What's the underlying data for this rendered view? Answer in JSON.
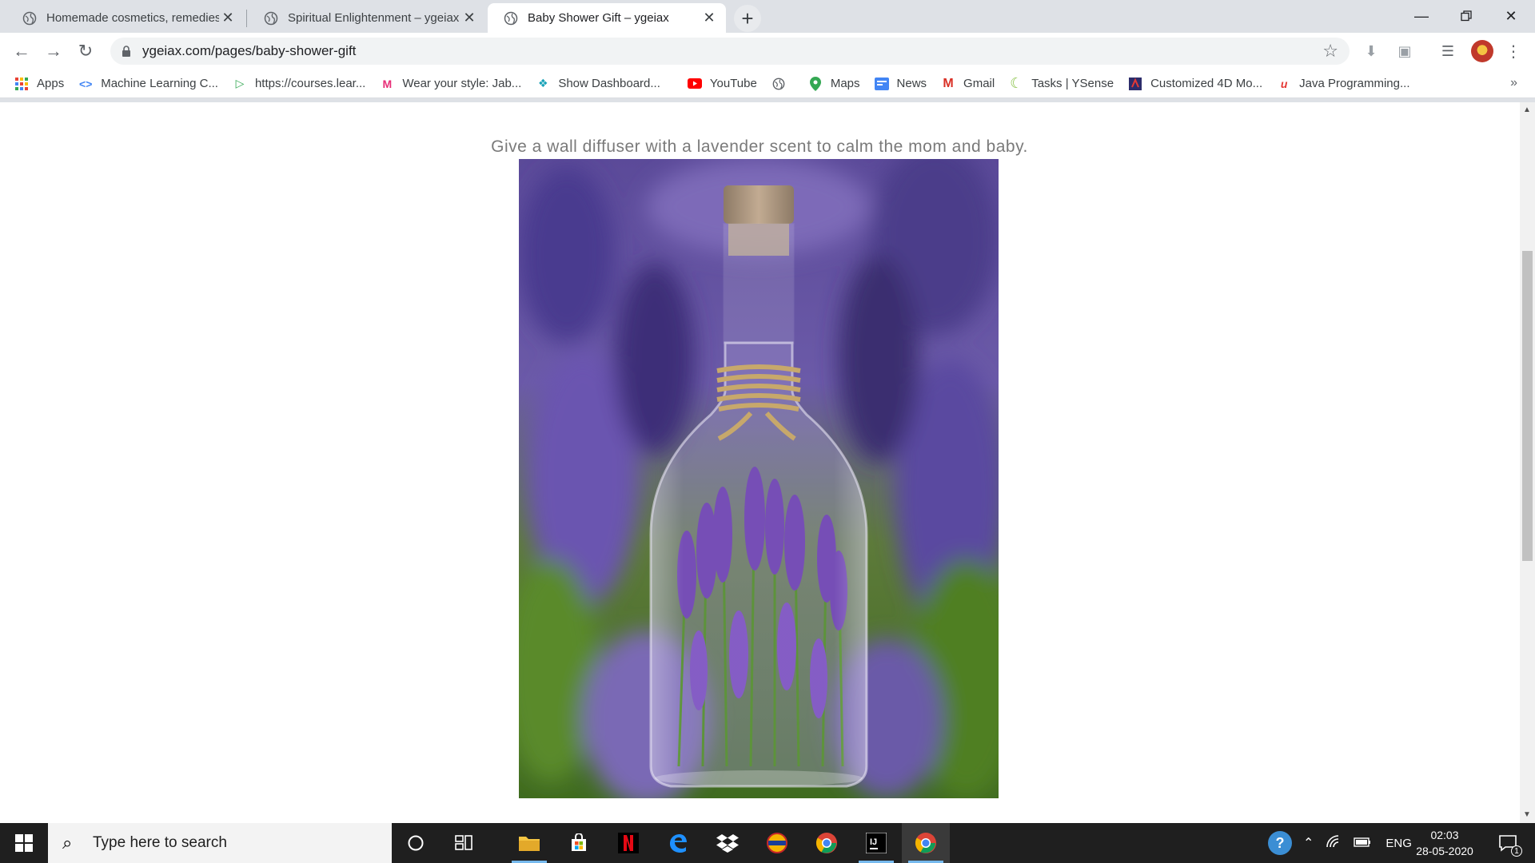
{
  "browser": {
    "tabs": [
      {
        "title": "Homemade cosmetics, remedies",
        "active": false
      },
      {
        "title": "Spiritual Enlightenment – ygeiax",
        "active": false
      },
      {
        "title": "Baby Shower Gift – ygeiax",
        "active": true
      }
    ],
    "url": "ygeiax.com/pages/baby-shower-gift",
    "bookmarks": [
      {
        "label": "Apps",
        "icon": "apps-grid-icon",
        "color": "#e94235"
      },
      {
        "label": "Machine Learning C...",
        "icon": "code-icon",
        "color": "#4285f4"
      },
      {
        "label": "https://courses.lear...",
        "icon": "play-icon",
        "color": "#34a853"
      },
      {
        "label": "Wear your style: Jab...",
        "icon": "myntra-icon",
        "color": "#e72e77"
      },
      {
        "label": "Show Dashboard...",
        "icon": "diamond-icon",
        "color": "#1aa3b8"
      },
      {
        "label": "YouTube",
        "icon": "youtube-icon",
        "color": "#ff0000"
      },
      {
        "label": "",
        "icon": "globe-icon",
        "color": "#5f6368"
      },
      {
        "label": "Maps",
        "icon": "maps-pin-icon",
        "color": "#34a853"
      },
      {
        "label": "News",
        "icon": "news-icon",
        "color": "#4285f4"
      },
      {
        "label": "Gmail",
        "icon": "gmail-icon",
        "color": "#d93025"
      },
      {
        "label": "Tasks | YSense",
        "icon": "ysense-icon",
        "color": "#8bc34a"
      },
      {
        "label": "Customized 4D Mo...",
        "icon": "4d-icon",
        "color": "#2d2d6b"
      },
      {
        "label": "Java Programming...",
        "icon": "java-icon",
        "color": "#e53935"
      }
    ]
  },
  "page": {
    "caption": "Give a wall diffuser with a lavender scent to calm the mom and baby."
  },
  "taskbar": {
    "search_placeholder": "Type here to search",
    "language": "ENG",
    "time": "02:03",
    "date": "28-05-2020",
    "notification_count": "1"
  }
}
